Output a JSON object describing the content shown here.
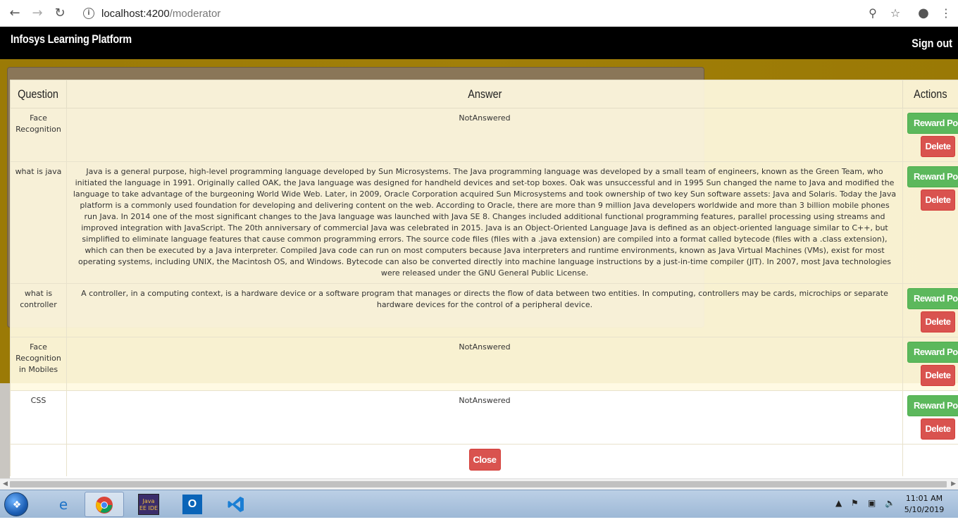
{
  "browser": {
    "url_host": "localhost:4200",
    "url_path": "/moderator"
  },
  "app": {
    "brand": "Infosys Learning Platform",
    "signout": "Sign out"
  },
  "table": {
    "headers": [
      "Question",
      "Answer",
      "Actions"
    ],
    "reward_label": "Reward Points",
    "delete_label": "Delete",
    "close_label": "Close",
    "rows": [
      {
        "question": "Face Recognition",
        "answer": "NotAnswered"
      },
      {
        "question": "what is java",
        "answer": "Java is a general purpose, high-level programming language developed by Sun Microsystems. The Java programming language was developed by a small team of engineers, known as the Green Team, who initiated the language in 1991. Originally called OAK, the Java language was designed for handheld devices and set-top boxes. Oak was unsuccessful and in 1995 Sun changed the name to Java and modified the language to take advantage of the burgeoning World Wide Web. Later, in 2009, Oracle Corporation acquired Sun Microsystems and took ownership of two key Sun software assets: Java and Solaris. Today the Java platform is a commonly used foundation for developing and delivering content on the web. According to Oracle, there are more than 9 million Java developers worldwide and more than 3 billion mobile phones run Java. In 2014 one of the most significant changes to the Java language was launched with Java SE 8. Changes included additional functional programming features, parallel processing using streams and improved integration with JavaScript. The 20th anniversary of commercial Java was celebrated in 2015. Java is an Object-Oriented Language Java is defined as an object-oriented language similar to C++, but simplified to eliminate language features that cause common programming errors. The source code files (files with a .java extension) are compiled into a format called bytecode (files with a .class extension), which can then be executed by a Java interpreter. Compiled Java code can run on most computers because Java interpreters and runtime environments, known as Java Virtual Machines (VMs), exist for most operating systems, including UNIX, the Macintosh OS, and Windows. Bytecode can also be converted directly into machine language instructions by a just-in-time compiler (JIT). In 2007, most Java technologies were released under the GNU General Public License."
      },
      {
        "question": "what is controller",
        "answer": "A controller, in a computing context, is a hardware device or a software program that manages or directs the flow of data between two entities. In computing, controllers may be cards, microchips or separate hardware devices for the control of a peripheral device."
      },
      {
        "question": "Face Recognition in Mobiles",
        "answer": "NotAnswered"
      },
      {
        "question": "CSS",
        "answer": "NotAnswered"
      }
    ]
  },
  "taskbar": {
    "time": "11:01 AM",
    "date": "5/10/2019",
    "javaee_label": "Java EE IDE"
  }
}
